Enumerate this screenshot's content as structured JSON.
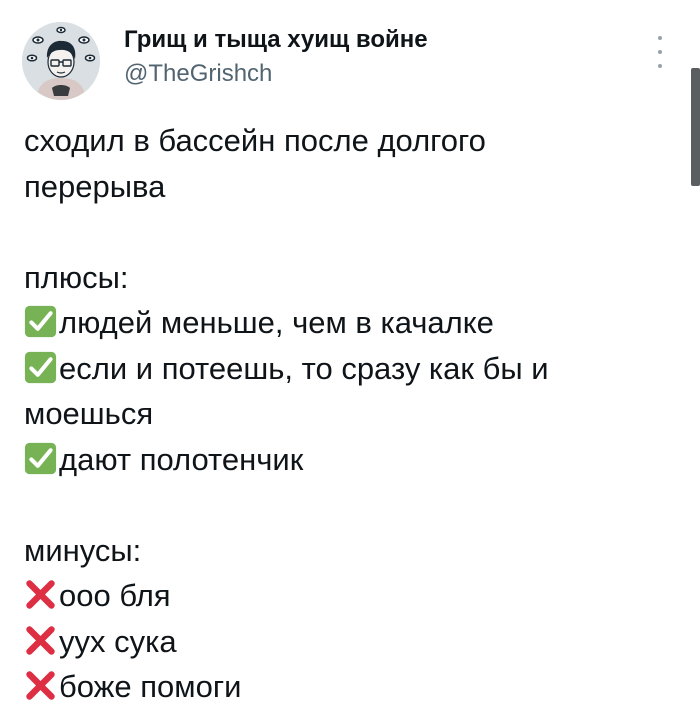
{
  "author": {
    "name": "Грищ и тыща хуищ войне",
    "handle": "@TheGrishch"
  },
  "post": {
    "intro_lines": [
      "сходил в бассейн после долгого",
      "перерыва"
    ],
    "pros_heading": "плюсы:",
    "pros": [
      "людей меньше, чем в качалке",
      "если и потеешь, то сразу как бы и",
      "моешься",
      "дают полотенчик"
    ],
    "cons_heading": "минусы:",
    "cons": [
      "ооо бля",
      "уух сука",
      "боже помоги"
    ]
  },
  "icons": {
    "pro_icon": "check-mark-button-emoji",
    "con_icon": "cross-mark-emoji",
    "more_icon": "more-vertical-icon"
  },
  "colors": {
    "text": "#0f1419",
    "handle": "#536471",
    "check_green": "#77b255",
    "cross_red": "#dd2e44"
  }
}
